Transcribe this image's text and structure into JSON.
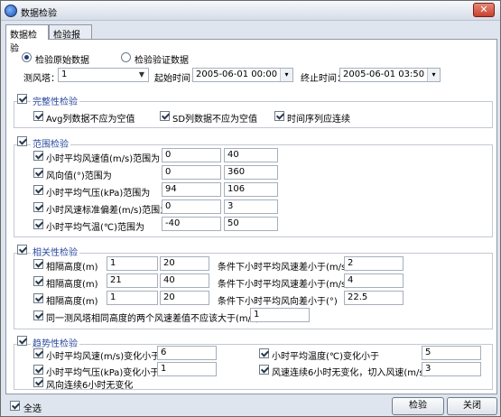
{
  "window": {
    "title": "数据检验",
    "close_label": "✕"
  },
  "tabs": [
    {
      "label": "数据检验"
    },
    {
      "label": "检验报告"
    }
  ],
  "source": {
    "raw_label": "检验原始数据",
    "verified_label": "检验验证数据"
  },
  "tower": {
    "label": "测风塔：",
    "value": "1"
  },
  "time": {
    "start_label": "起始时间：",
    "start_value": "2005-06-01 00:00",
    "end_label": "终止时间：",
    "end_value": "2005-06-01 03:50"
  },
  "completeness": {
    "title": "完整性检验",
    "avg_label": "Avg列数据不应为空值",
    "sd_label": "SD列数据不应为空值",
    "seq_label": "时间序列应连续"
  },
  "range": {
    "title": "范围检验",
    "rows": [
      {
        "label": "小时平均风速值(m/s)范围为",
        "min": "0",
        "max": "40"
      },
      {
        "label": "风向值(°)范围为",
        "min": "0",
        "max": "360"
      },
      {
        "label": "小时平均气压(kPa)范围为",
        "min": "94",
        "max": "106"
      },
      {
        "label": "小时风速标准偏差(m/s)范围为",
        "min": "0",
        "max": "3"
      },
      {
        "label": "小时平均气温(℃)范围为",
        "min": "-40",
        "max": "50"
      }
    ]
  },
  "correlation": {
    "title": "相关性检验",
    "rows": [
      {
        "label": "相隔高度(m)",
        "h1": "1",
        "h2": "20",
        "cond": "条件下小时平均风速差小于(m/s)",
        "val": "2"
      },
      {
        "label": "相隔高度(m)",
        "h1": "21",
        "h2": "40",
        "cond": "条件下小时平均风速差小于(m/s)",
        "val": "4"
      },
      {
        "label": "相隔高度(m)",
        "h1": "1",
        "h2": "20",
        "cond": "条件下小时平均风向差小于(°)",
        "val": "22.5"
      }
    ],
    "same_label": "同一测风塔相同高度的两个风速差值不应该大于(m/s)",
    "same_value": "1"
  },
  "trend": {
    "title": "趋势性检验",
    "wind_label": "小时平均风速(m/s)变化小于",
    "wind_value": "6",
    "pressure_label": "小时平均气压(kPa)变化小于",
    "pressure_value": "1",
    "dir_label": "风向连续6小时无变化",
    "temp_label": "小时平均温度(℃)变化小于",
    "temp_value": "5",
    "cutin_label": "风速连续6小时无变化，切入风速(m/s)",
    "cutin_value": "3"
  },
  "footer": {
    "select_all_label": "全选",
    "check_button": "检验",
    "close_button": "关闭"
  }
}
